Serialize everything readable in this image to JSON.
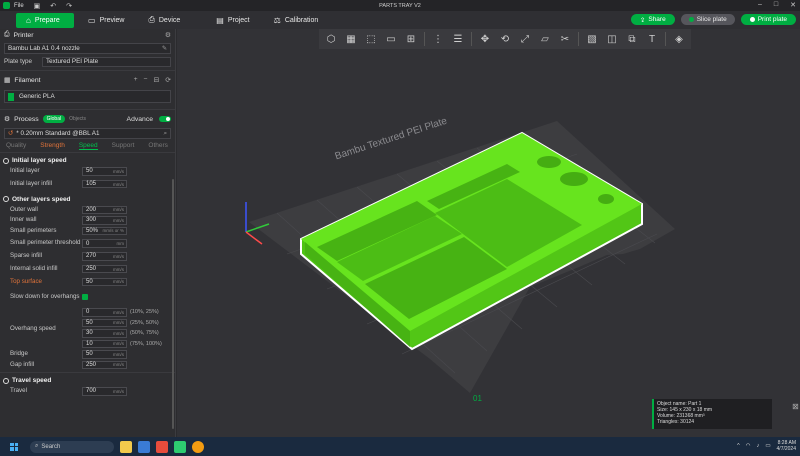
{
  "titlebar": {
    "menu": "File",
    "title": "PARTS TRAY V2",
    "icons": [
      "save-icon",
      "undo-icon",
      "redo-icon"
    ]
  },
  "toolbar": {
    "tabs": [
      {
        "label": "Prepare",
        "icon": "home-icon",
        "active": true
      },
      {
        "label": "Preview",
        "icon": "preview-icon",
        "active": false
      },
      {
        "label": "Device",
        "icon": "device-icon",
        "active": false
      },
      {
        "label": "Project",
        "icon": "project-icon",
        "active": false
      },
      {
        "label": "Calibration",
        "icon": "calibration-icon",
        "active": false
      }
    ],
    "share_label": "Share",
    "slice_label": "Slice plate",
    "print_label": "Print plate"
  },
  "sidebar": {
    "printer": {
      "title": "Printer",
      "name": "Bambu Lab A1 0.4 nozzle",
      "plate_label": "Plate type",
      "plate_value": "Textured PEI Plate"
    },
    "filament": {
      "title": "Filament",
      "item": "Generic PLA"
    },
    "process": {
      "title": "Process",
      "chip_global": "Global",
      "chip_objects": "Objects",
      "advanced_label": "Advance",
      "profile": "* 0.20mm Standard @BBL A1",
      "subtabs": [
        "Quality",
        "Strength",
        "Speed",
        "Support",
        "Others"
      ]
    },
    "groups": {
      "initial": "Initial layer speed",
      "other": "Other layers speed",
      "travel": "Travel speed"
    },
    "initial_rows": [
      {
        "label": "Initial layer",
        "value": "50",
        "unit": "mm/s"
      },
      {
        "label": "Initial layer infill",
        "value": "105",
        "unit": "mm/s"
      }
    ],
    "other_rows": [
      {
        "label": "Outer wall",
        "value": "200",
        "unit": "mm/s"
      },
      {
        "label": "Inner wall",
        "value": "300",
        "unit": "mm/s"
      },
      {
        "label": "Small perimeters",
        "value": "50%",
        "unit": "mm/s or %"
      },
      {
        "label": "Small perimeter threshold",
        "value": "0",
        "unit": "mm"
      },
      {
        "label": "Sparse infill",
        "value": "270",
        "unit": "mm/s"
      },
      {
        "label": "Internal solid infill",
        "value": "250",
        "unit": "mm/s"
      },
      {
        "label": "Top surface",
        "value": "50",
        "unit": "mm/s"
      }
    ],
    "slowdown_label": "Slow down for overhangs",
    "overhang_label": "Overhang speed",
    "overhang_rows": [
      {
        "value": "0",
        "unit": "mm/s",
        "range": "(10%, 25%)"
      },
      {
        "value": "50",
        "unit": "mm/s",
        "range": "(25%, 50%)"
      },
      {
        "value": "30",
        "unit": "mm/s",
        "range": "(50%, 75%)"
      },
      {
        "value": "10",
        "unit": "mm/s",
        "range": "(75%, 100%)"
      }
    ],
    "bridge": {
      "label": "Bridge",
      "value": "50",
      "unit": "mm/s"
    },
    "gap": {
      "label": "Gap infill",
      "value": "250",
      "unit": "mm/s"
    },
    "travel": {
      "label": "Travel",
      "value": "700",
      "unit": "mm/s"
    }
  },
  "viewport": {
    "plate_text": "Bambu Textured PEI Plate",
    "plate_number": "01",
    "object_info": {
      "name": "Object name: Part 1",
      "size": "Size: 145 x 230 x 18 mm",
      "volume": "Volume: 231368 mm³",
      "triangles": "Triangles: 30124"
    }
  },
  "taskbar": {
    "search": "Search",
    "time": "8:28 AM",
    "date": "4/7/2024"
  },
  "colors": {
    "accent": "#00ae42",
    "model": "#5ce21a",
    "bg": "#2b2b2e"
  }
}
